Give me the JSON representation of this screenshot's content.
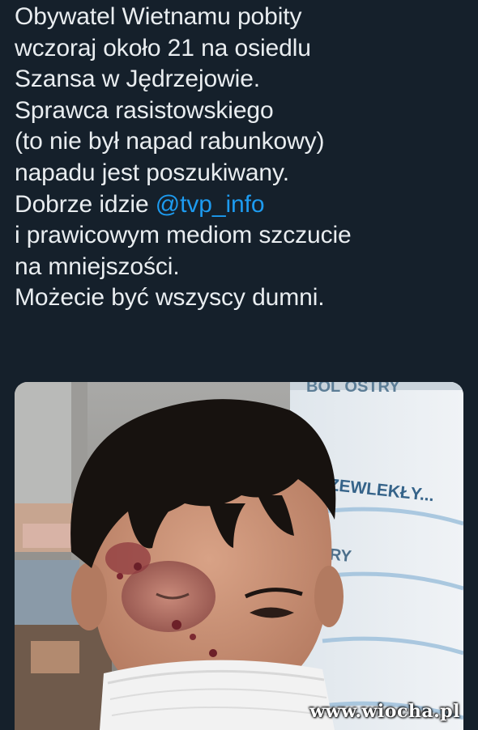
{
  "tweet": {
    "lines": [
      "Obywatel Wietnamu pobity",
      "wczoraj około 21 na osiedlu",
      "Szansa w Jędrzejowie.",
      "Sprawca rasistowskiego",
      "(to nie był napad rabunkowy)",
      "napadu jest poszukiwany."
    ],
    "line7_prefix": "Dobrze idzie ",
    "mention": "@tvp_info",
    "lines_after": [
      "i prawicowym mediom szczucie",
      "na mniejszości.",
      "Możecie być wszyscy dumni."
    ]
  },
  "media": {
    "sign_text_top": "BÓL OSTRY",
    "sign_text_mid": "RZEWLEKŁY...",
    "sign_text_low": "TRY"
  },
  "watermark": "www.wiocha.pl"
}
